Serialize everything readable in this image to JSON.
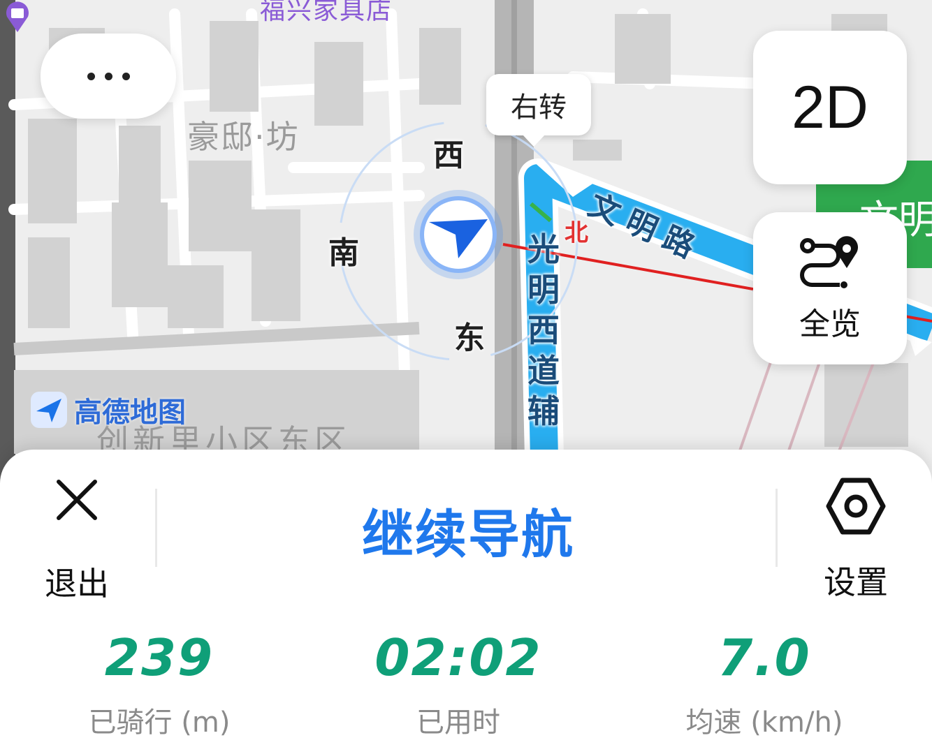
{
  "map": {
    "poi_top": "福兴家具店",
    "area_label_1": "豪邸·坊",
    "area_label_2": "创新里小区东区",
    "compass": {
      "west": "西",
      "south": "南",
      "east": "东"
    },
    "north_marker": "北",
    "road_vertical": "光明西道辅",
    "road_right": "文明路",
    "road_aux": "辅",
    "green_sign_text": "文明",
    "brand_text": "高德地图"
  },
  "more_button": {
    "icon": "more-dots-icon"
  },
  "turn_tip": "右转",
  "view_mode_button": "2D",
  "overview_button": {
    "label": "全览",
    "icon": "route-overview-icon"
  },
  "panel": {
    "exit_label": "退出",
    "continue_label": "继续导航",
    "settings_label": "设置",
    "stats": [
      {
        "value": "239",
        "label": "已骑行 (m)"
      },
      {
        "value": "02:02",
        "label": "已用时"
      },
      {
        "value": "7.0",
        "label": "均速 (km/h)"
      }
    ]
  },
  "colors": {
    "accent_blue": "#1f78ec",
    "stat_green": "#0f9f78",
    "route_cyan": "#29aef0",
    "route_red": "#e02020",
    "sign_green": "#2fa84e"
  }
}
